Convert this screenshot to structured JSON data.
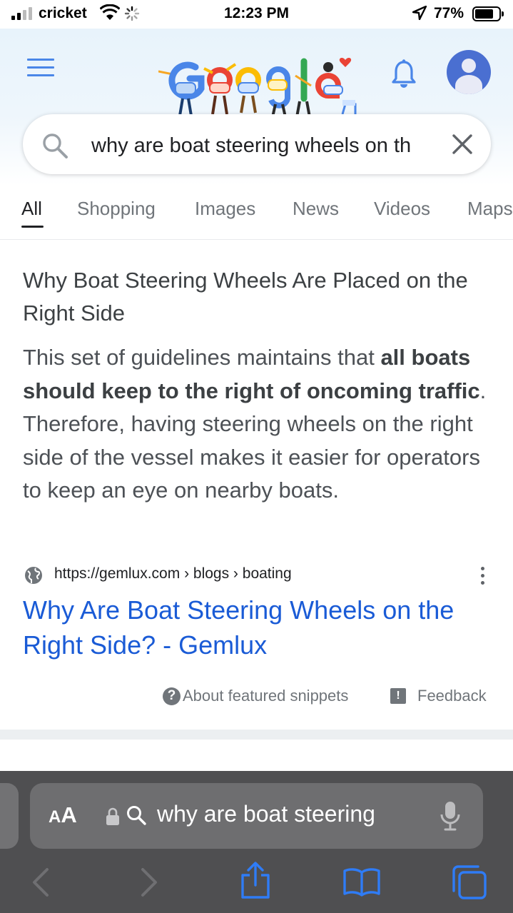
{
  "status_bar": {
    "carrier": "cricket",
    "time": "12:23 PM",
    "battery_percent": "77%",
    "battery_level": 0.77,
    "icons": [
      "signal-bars-icon",
      "wifi-icon",
      "loading-spinner-icon",
      "location-arrow-icon",
      "battery-icon"
    ]
  },
  "header": {
    "menu_icon": "hamburger-menu-icon",
    "logo": "google-doodle",
    "notifications_icon": "bell-icon",
    "account_icon": "avatar-icon"
  },
  "search": {
    "query": "why are boat steering wheels on th",
    "search_icon": "search-icon",
    "clear_icon": "close-icon"
  },
  "tabs": [
    {
      "label": "All",
      "active": true
    },
    {
      "label": "Shopping"
    },
    {
      "label": "Images"
    },
    {
      "label": "News"
    },
    {
      "label": "Videos"
    },
    {
      "label": "Maps"
    }
  ],
  "snippet": {
    "title": "Why Boat Steering Wheels Are Placed on the Right Side",
    "body_before": "This set of guidelines maintains that ",
    "body_bold": "all boats should keep to the right of oncoming traffic",
    "body_after": ". Therefore, having steering wheels on the right side of the vessel makes it easier for operators to keep an eye on nearby boats.",
    "source_url": "https://gemlux.com › blogs › boating",
    "link_title": "Why Are Boat Steering Wheels on the Right Side? - Gemlux",
    "about_label": "About featured snippets",
    "feedback_label": "Feedback"
  },
  "next_section": {
    "heading": ""
  },
  "safari": {
    "aa_small": "A",
    "aa_big": "A",
    "address_text": "why are boat steering",
    "toolbar_icons": [
      "back-arrow-icon",
      "forward-arrow-icon",
      "share-icon",
      "bookmarks-icon",
      "tabs-icon"
    ],
    "accent": "#2f7cf6"
  },
  "colors": {
    "link_blue": "#1a5bd6",
    "header_tint": "#e8f3fb",
    "safari_bg": "#4f4f51"
  }
}
